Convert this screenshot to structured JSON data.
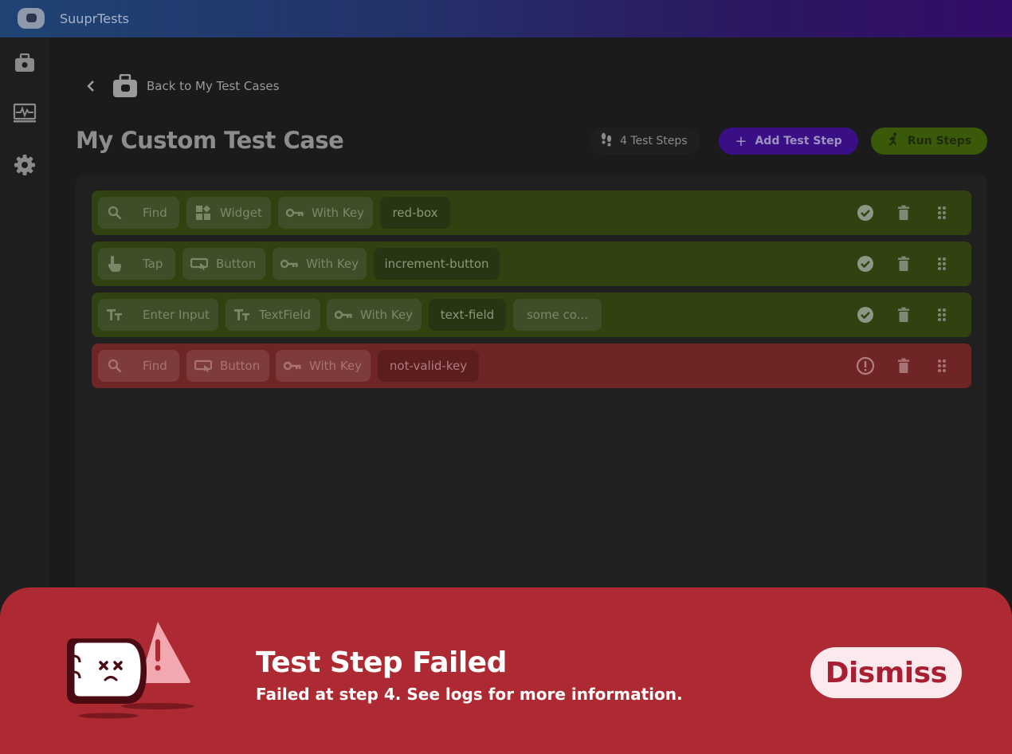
{
  "app": {
    "name": "SuuprTests"
  },
  "sidebar": {
    "items": [
      {
        "icon": "briefcase-icon"
      },
      {
        "icon": "monitor-heartbeat-icon"
      },
      {
        "icon": "gear-icon"
      }
    ]
  },
  "header": {
    "back_label": "Back to My Test Cases",
    "title": "My Custom Test Case",
    "steps_count": "4 Test Steps",
    "add_label": "Add Test Step",
    "run_label": "Run Steps"
  },
  "steps": [
    {
      "status": "passed",
      "action": {
        "label": "Find",
        "icon": "search-icon"
      },
      "target": {
        "label": "Widget",
        "icon": "widgets-icon"
      },
      "by": {
        "label": "With Key",
        "icon": "key-icon"
      },
      "values": [
        "red-box"
      ]
    },
    {
      "status": "passed",
      "action": {
        "label": "Tap",
        "icon": "touch-icon"
      },
      "target": {
        "label": "Button",
        "icon": "button-icon"
      },
      "by": {
        "label": "With Key",
        "icon": "key-icon"
      },
      "values": [
        "increment-button"
      ]
    },
    {
      "status": "passed",
      "action": {
        "label": "Enter Input",
        "icon": "text-icon"
      },
      "target": {
        "label": "TextField",
        "icon": "text-icon"
      },
      "by": {
        "label": "With Key",
        "icon": "key-icon"
      },
      "values": [
        "text-field",
        "some co..."
      ]
    },
    {
      "status": "failed",
      "action": {
        "label": "Find",
        "icon": "search-icon"
      },
      "target": {
        "label": "Button",
        "icon": "button-icon"
      },
      "by": {
        "label": "With Key",
        "icon": "key-icon"
      },
      "values": [
        "not-valid-key"
      ]
    }
  ],
  "toast": {
    "title": "Test Step Failed",
    "message": "Failed at step 4. See logs for more information.",
    "dismiss_label": "Dismiss"
  },
  "colors": {
    "passed_row": "#30420f",
    "failed_row": "#6f2526",
    "toast_bg": "#ae2a33",
    "add_button": "#3a0f86",
    "run_button": "#3a5a09"
  }
}
